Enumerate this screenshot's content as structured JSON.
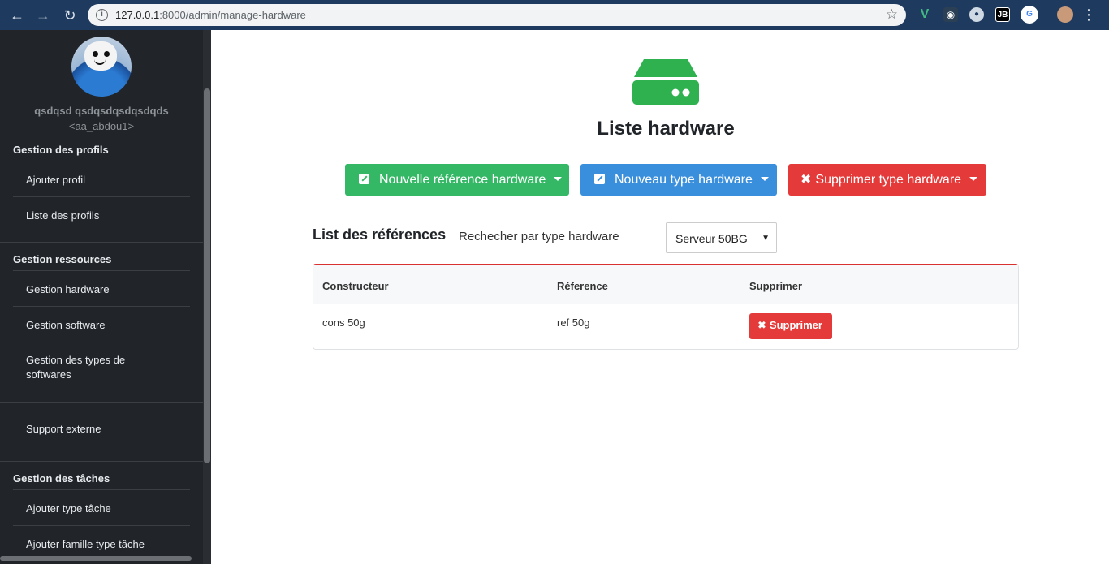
{
  "browser": {
    "url_host": "127.0.0.1",
    "url_path": ":8000/admin/manage-hardware",
    "extensions": [
      "vue-icon",
      "spy-icon",
      "circle-icon",
      "jb-icon",
      "translate-icon",
      "profile-icon"
    ],
    "ext_jb": "JB"
  },
  "sidebar": {
    "user_name": "qsdqsd qsdqsdqsdqsdqds",
    "user_handle": "<aa_abdou1>",
    "sections": [
      {
        "title": "Gestion des profils",
        "items": [
          "Ajouter profil",
          "Liste des profils"
        ]
      },
      {
        "title": "Gestion ressources",
        "items": [
          "Gestion hardware",
          "Gestion software",
          "Gestion des types de softwares"
        ]
      },
      {
        "title": "",
        "items": [
          "Support externe"
        ]
      },
      {
        "title": "Gestion des tâches",
        "items": [
          "Ajouter type tâche",
          "Ajouter famille type tâche"
        ]
      }
    ]
  },
  "main": {
    "title": "Liste hardware",
    "buttons": {
      "new_reference": "Nouvelle référence hardware",
      "new_type": "Nouveau type hardware",
      "delete_type": "Supprimer type hardware"
    },
    "list_title": "List des références",
    "search_label": "Rechecher par type hardware",
    "select_value": "Serveur 50BG",
    "table": {
      "headers": [
        "Constructeur",
        "Réference",
        "Supprimer"
      ],
      "rows": [
        {
          "constructeur": "cons 50g",
          "reference": "ref 50g",
          "action": "Supprimer"
        }
      ]
    }
  },
  "colors": {
    "green": "#35b866",
    "blue": "#3a8fdd",
    "red": "#e53a3a",
    "sidebar": "#212529"
  }
}
